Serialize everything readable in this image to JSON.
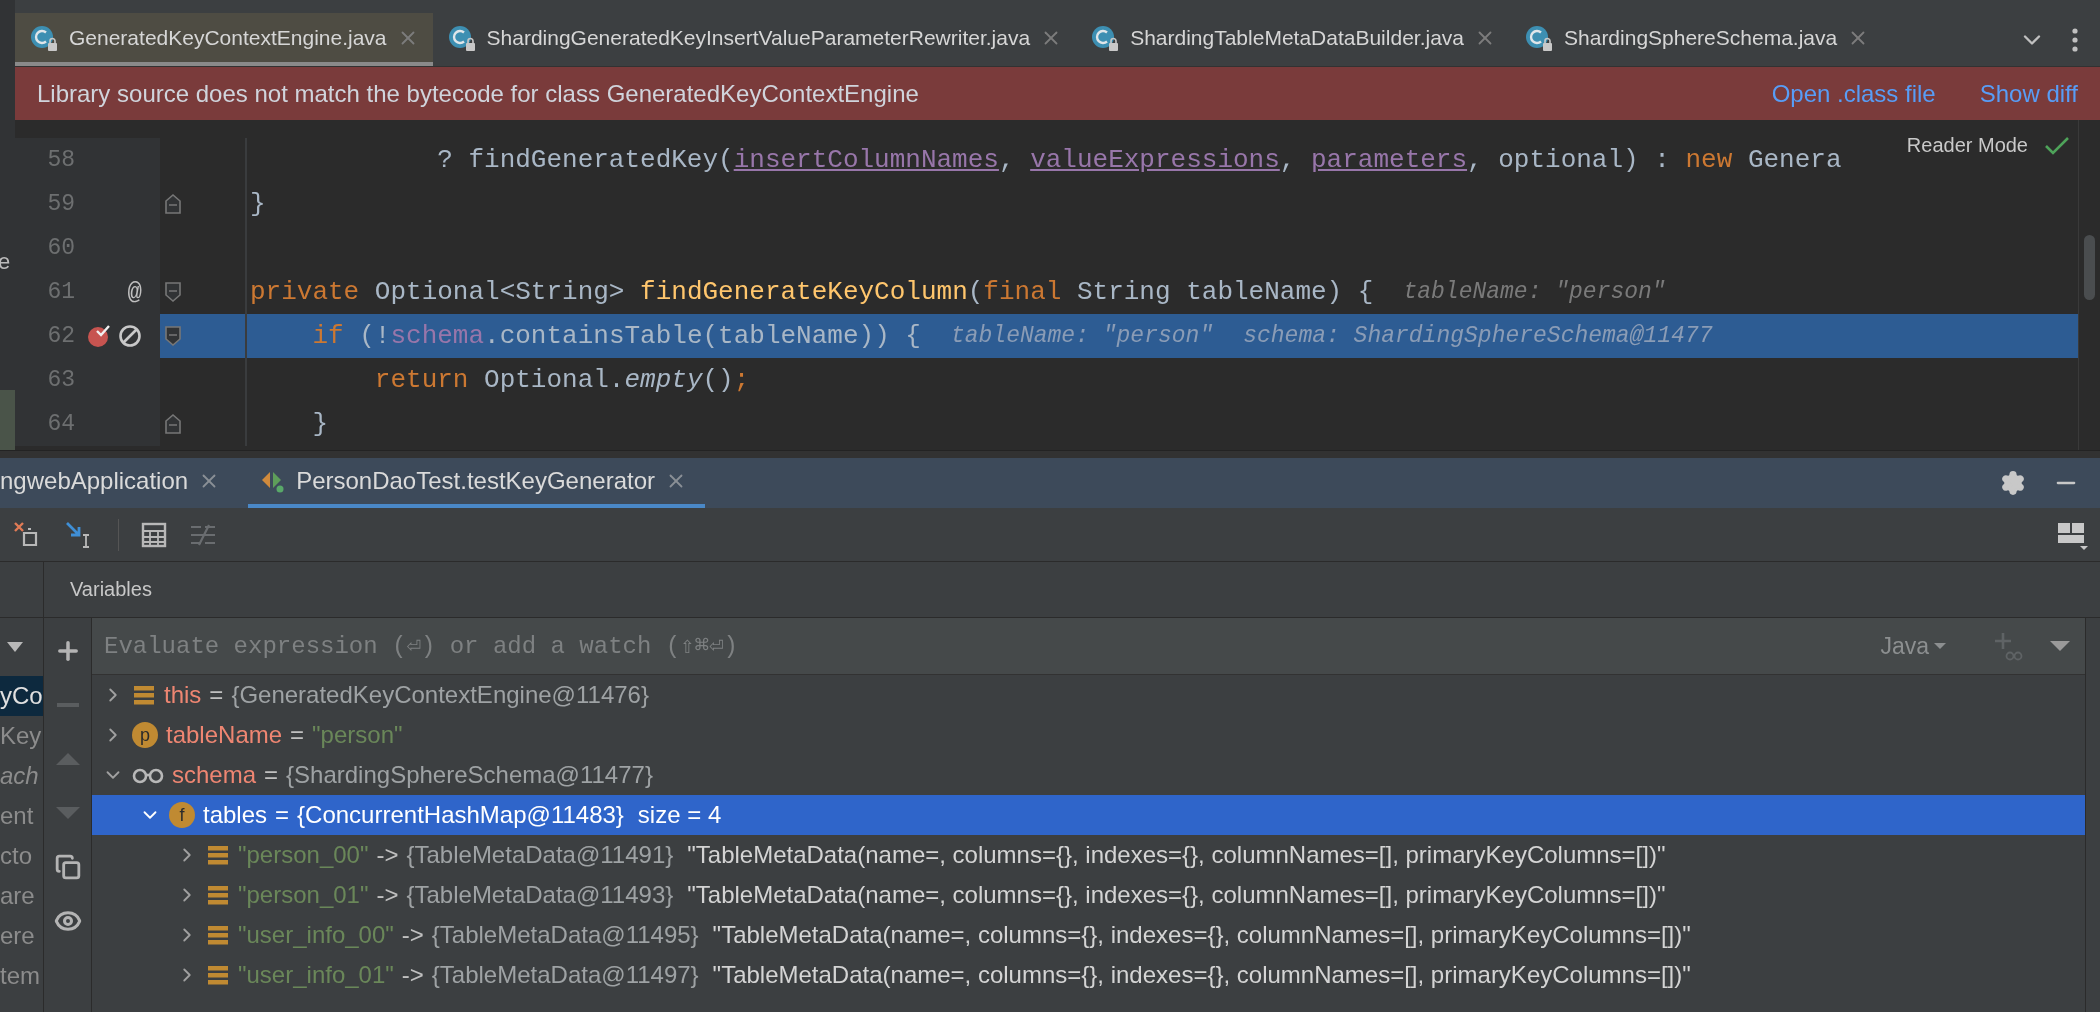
{
  "editor_tabs": [
    {
      "title": "GeneratedKeyContextEngine.java",
      "selected": true
    },
    {
      "title": "ShardingGeneratedKeyInsertValueParameterRewriter.java",
      "selected": false
    },
    {
      "title": "ShardingTableMetaDataBuilder.java",
      "selected": false
    },
    {
      "title": "ShardingSphereSchema.java",
      "selected": false
    }
  ],
  "banner": {
    "message": "Library source does not match the bytecode for class GeneratedKeyContextEngine",
    "links": [
      "Open .class file",
      "Show diff"
    ]
  },
  "reader_mode": "Reader Mode",
  "side_fragment": "e",
  "code_lines": [
    {
      "number": "58",
      "current": false,
      "breakpoint": false,
      "blocked": false,
      "tokens": [
        {
          "kind": "plain",
          "t": "            ? findGeneratedKey("
        },
        {
          "kind": "ref",
          "t": "insertColumnNames"
        },
        {
          "kind": "plain",
          "t": ", "
        },
        {
          "kind": "ref",
          "t": "valueExpressions"
        },
        {
          "kind": "plain",
          "t": ", "
        },
        {
          "kind": "ref",
          "t": "parameters"
        },
        {
          "kind": "plain",
          "t": ", optional) : "
        },
        {
          "kind": "keyword",
          "t": "new"
        },
        {
          "kind": "plain",
          "t": " Genera"
        }
      ]
    },
    {
      "number": "59",
      "current": false,
      "breakpoint": false,
      "blocked": false,
      "fold": {
        "kind": "end"
      },
      "tokens": [
        {
          "kind": "plain",
          "t": "}"
        }
      ]
    },
    {
      "number": "60",
      "current": false,
      "breakpoint": false,
      "blocked": false
    },
    {
      "number": "61",
      "current": false,
      "breakpoint": false,
      "blocked": false,
      "fold": {
        "kind": "start"
      },
      "gutter_mark": "@",
      "tokens": [
        {
          "kind": "keyword",
          "t": "private"
        },
        {
          "kind": "plain",
          "t": " Optional<String> "
        },
        {
          "kind": "method",
          "t": "findGenerateKeyColumn"
        },
        {
          "kind": "plain",
          "t": "("
        },
        {
          "kind": "keyword",
          "t": "final"
        },
        {
          "kind": "plain",
          "t": " String tableName) {"
        }
      ],
      "hints": [
        "tableName: \"person\""
      ]
    },
    {
      "number": "62",
      "current": true,
      "breakpoint": true,
      "blocked": true,
      "fold": {
        "kind": "start"
      },
      "tokens": [
        {
          "kind": "keyword",
          "t": "    if"
        },
        {
          "kind": "plain",
          "t": " (!"
        },
        {
          "kind": "field",
          "t": "schema"
        },
        {
          "kind": "plain",
          "t": ".containsTable(tableName)) {"
        }
      ],
      "hints": [
        "tableName: \"person\"",
        "schema: ShardingSphereSchema@11477"
      ]
    },
    {
      "number": "63",
      "current": false,
      "breakpoint": false,
      "blocked": false,
      "tokens": [
        {
          "kind": "keyword",
          "t": "        return"
        },
        {
          "kind": "plain",
          "t": " Optional."
        },
        {
          "kind": "static",
          "t": "empty"
        },
        {
          "kind": "plain",
          "t": "()"
        },
        {
          "kind": "keyword",
          "t": ";"
        }
      ]
    },
    {
      "number": "64",
      "current": false,
      "breakpoint": false,
      "blocked": false,
      "fold": {
        "kind": "end"
      },
      "tokens": [
        {
          "kind": "plain",
          "t": "    }"
        }
      ]
    }
  ],
  "debug_tabs": [
    {
      "title": "ngwebApplication",
      "selected": false,
      "kind": "app"
    },
    {
      "title": "PersonDaoTest.testKeyGenerator",
      "selected": true,
      "kind": "test"
    }
  ],
  "variables_title": "Variables",
  "frames": [
    {
      "text": "yCo",
      "selected": true,
      "italic": false
    },
    {
      "text": "Key",
      "selected": false,
      "italic": false
    },
    {
      "text": "ach",
      "selected": false,
      "italic": true
    },
    {
      "text": "ent",
      "selected": false,
      "italic": false
    },
    {
      "text": "cto",
      "selected": false,
      "italic": false
    },
    {
      "text": "are",
      "selected": false,
      "italic": false
    },
    {
      "text": "ere",
      "selected": false,
      "italic": false
    },
    {
      "text": "tem",
      "selected": false,
      "italic": false
    }
  ],
  "evaluate": {
    "placeholder": "Evaluate expression (⏎) or add a watch (⇧⌘⏎)",
    "language": "Java"
  },
  "variables": [
    {
      "kind": "field",
      "name": "this",
      "op": "=",
      "value": "{GeneratedKeyContextEngine@11476}",
      "string_value": false,
      "expanded": false,
      "selected": false
    },
    {
      "kind": "badge",
      "badge": "p",
      "name": "tableName",
      "op": "=",
      "value": "\"person\"",
      "string_value": true,
      "expanded": false,
      "selected": false
    },
    {
      "kind": "watch",
      "name": "schema",
      "op": "=",
      "value": "{ShardingSphereSchema@11477}",
      "string_value": false,
      "expanded": true,
      "selected": false,
      "children": [
        {
          "kind": "badge",
          "badge": "f",
          "name": "tables",
          "op": "=",
          "value": "{ConcurrentHashMap@11483}",
          "string_value": false,
          "detail": "size = 4",
          "expanded": true,
          "selected": true,
          "children": [
            {
              "kind": "entry",
              "name": "\"person_00\"",
              "op": "->",
              "value": "{TableMetaData@11491}",
              "string_value": false,
              "detail": "\"TableMetaData(name=, columns={}, indexes={}, columnNames=[], primaryKeyColumns=[])\"",
              "expanded": false,
              "selected": false
            },
            {
              "kind": "entry",
              "name": "\"person_01\"",
              "op": "->",
              "value": "{TableMetaData@11493}",
              "string_value": false,
              "detail": "\"TableMetaData(name=, columns={}, indexes={}, columnNames=[], primaryKeyColumns=[])\"",
              "expanded": false,
              "selected": false
            },
            {
              "kind": "entry",
              "name": "\"user_info_00\"",
              "op": "->",
              "value": "{TableMetaData@11495}",
              "string_value": false,
              "detail": "\"TableMetaData(name=, columns={}, indexes={}, columnNames=[], primaryKeyColumns=[])\"",
              "expanded": false,
              "selected": false
            },
            {
              "kind": "entry",
              "name": "\"user_info_01\"",
              "op": "->",
              "value": "{TableMetaData@11497}",
              "string_value": false,
              "detail": "\"TableMetaData(name=, columns={}, indexes={}, columnNames=[], primaryKeyColumns=[])\"",
              "expanded": false,
              "selected": false
            }
          ]
        }
      ]
    }
  ]
}
